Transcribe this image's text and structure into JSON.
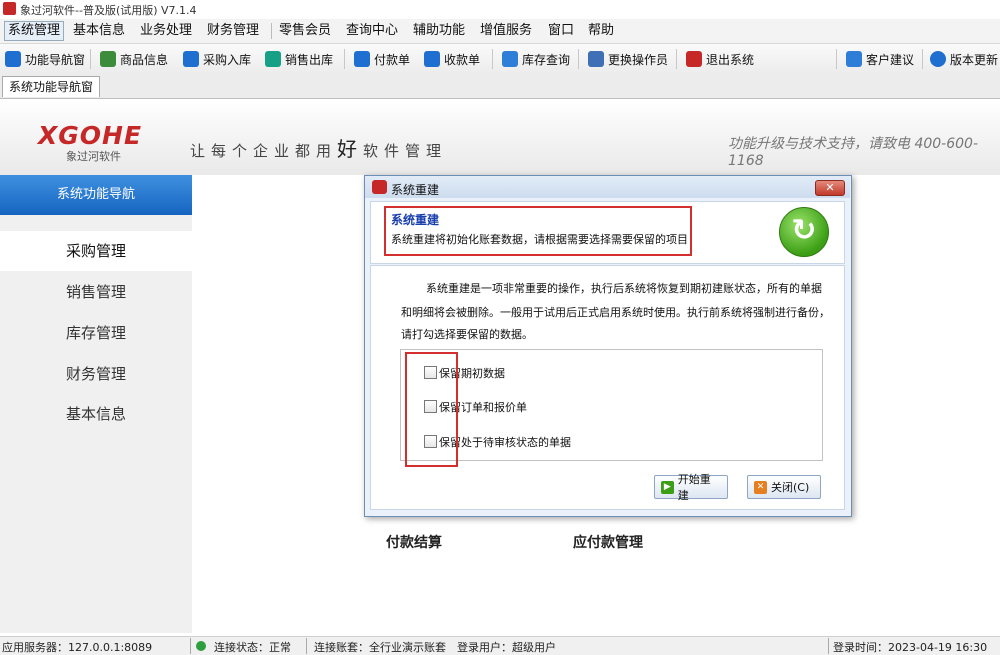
{
  "window": {
    "title": "象过河软件--普及版(试用版) V7.1.4"
  },
  "menu": [
    {
      "label": "系统管理"
    },
    {
      "label": "基本信息"
    },
    {
      "label": "业务处理"
    },
    {
      "label": "财务管理"
    },
    {
      "label": "零售会员"
    },
    {
      "label": "查询中心"
    },
    {
      "label": "辅助功能"
    },
    {
      "label": "增值服务"
    },
    {
      "label": "窗口"
    },
    {
      "label": "帮助"
    }
  ],
  "toolbar": {
    "items": [
      {
        "label": "功能导航窗",
        "icon": "home-icon"
      },
      {
        "label": "商品信息",
        "icon": "goods-icon"
      },
      {
        "label": "采购入库",
        "icon": "purchase-icon"
      },
      {
        "label": "销售出库",
        "icon": "sales-icon"
      },
      {
        "label": "付款单",
        "icon": "payment-icon"
      },
      {
        "label": "收款单",
        "icon": "receipt-icon"
      },
      {
        "label": "库存查询",
        "icon": "search-icon"
      },
      {
        "label": "更换操作员",
        "icon": "users-icon"
      },
      {
        "label": "退出系统",
        "icon": "exit-icon"
      },
      {
        "label": "客户建议",
        "icon": "feedback-icon"
      },
      {
        "label": "版本更新",
        "icon": "globe-icon"
      }
    ]
  },
  "tabs": [
    {
      "label": "系统功能导航窗"
    }
  ],
  "banner": {
    "logo": "XGOHE",
    "logo_sub": "象过河软件",
    "slogan_pre": "让每个企业都用",
    "slogan_big": "好",
    "slogan_post": "软件管理",
    "hotline": "功能升级与技术支持，请致电 400-600-1168"
  },
  "sidebar": {
    "header": "系统功能导航",
    "items": [
      {
        "label": "采购管理"
      },
      {
        "label": "销售管理"
      },
      {
        "label": "库存管理"
      },
      {
        "label": "财务管理"
      },
      {
        "label": "基本信息"
      }
    ]
  },
  "main": {
    "labels": [
      {
        "text": "付款结算"
      },
      {
        "text": "应付款管理"
      }
    ]
  },
  "dialog": {
    "title": "系统重建",
    "close_label": "✕",
    "header_title": "系统重建",
    "header_subtitle": "系统重建将初始化账套数据，请根据需要选择需要保留的项目",
    "description": [
      "系统重建是一项非常重要的操作，执行后系统将恢复到期初建账状态，所有的单据",
      "和明细将会被删除。一般用于试用后正式启用系统时使用。执行前系统将强制进行备份，",
      "请打勾选择要保留的数据。"
    ],
    "options": [
      {
        "label": "保留期初数据",
        "checked": false
      },
      {
        "label": "保留订单和报价单",
        "checked": false
      },
      {
        "label": "保留处于待审核状态的单据",
        "checked": false
      }
    ],
    "start_button": "开始重建",
    "close_button": "关闭(C)"
  },
  "statusbar": {
    "server": "应用服务器：127.0.0.1:8089",
    "connection": "连接状态：正常",
    "account": "连接账套：全行业演示账套",
    "user": "登录用户：超级用户",
    "login_time": "登录时间：2023-04-19 16:30"
  },
  "colors": {
    "accent": "#1565c0",
    "brand": "#c62828",
    "highlight": "#d32f2f"
  }
}
